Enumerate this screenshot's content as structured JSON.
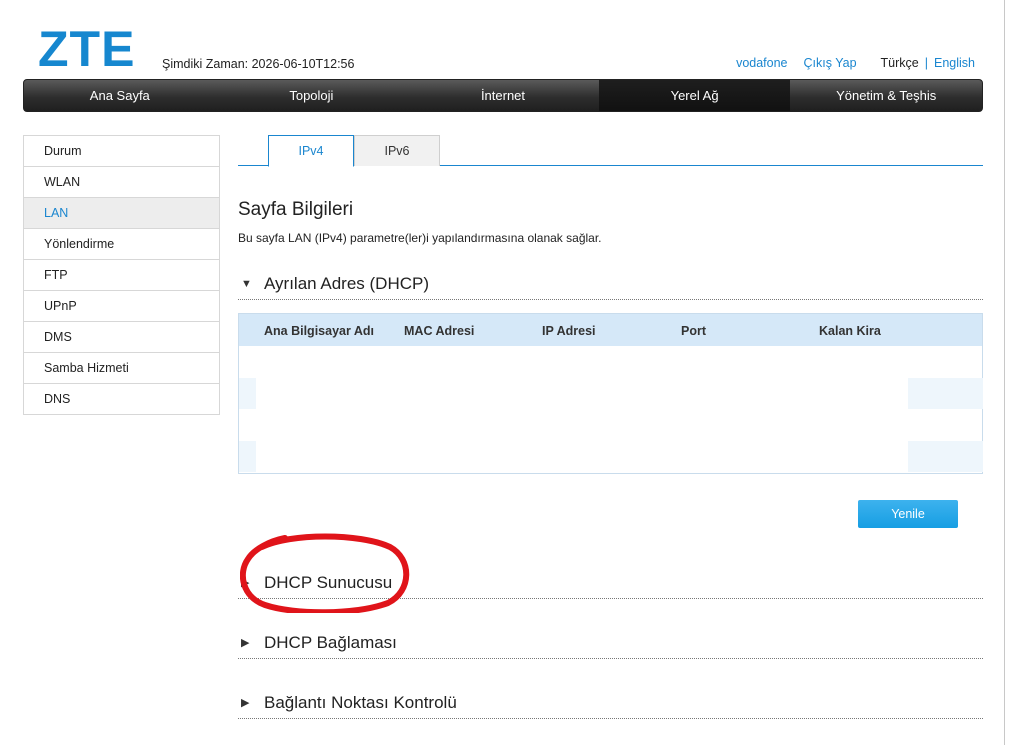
{
  "header": {
    "logo": "ZTE",
    "current_time": "Şimdiki Zaman: 2026-06-10T12:56",
    "links": {
      "operator": "vodafone",
      "logout": "Çıkış Yap",
      "lang_current": "Türkçe",
      "lang_separator": "|",
      "lang_alt": "English"
    }
  },
  "nav": {
    "items": [
      {
        "label": "Ana Sayfa"
      },
      {
        "label": "Topoloji"
      },
      {
        "label": "İnternet"
      },
      {
        "label": "Yerel Ağ"
      },
      {
        "label": "Yönetim & Teşhis"
      }
    ],
    "active": "Yerel Ağ"
  },
  "sidebar": {
    "items": [
      {
        "label": "Durum"
      },
      {
        "label": "WLAN"
      },
      {
        "label": "LAN"
      },
      {
        "label": "Yönlendirme"
      },
      {
        "label": "FTP"
      },
      {
        "label": "UPnP"
      },
      {
        "label": "DMS"
      },
      {
        "label": "Samba Hizmeti"
      },
      {
        "label": "DNS"
      }
    ],
    "active": "LAN"
  },
  "tabs": {
    "items": [
      {
        "label": "IPv4"
      },
      {
        "label": "IPv6"
      }
    ],
    "active": "IPv4"
  },
  "main": {
    "title": "Sayfa Bilgileri",
    "description": "Bu sayfa LAN (IPv4) parametre(ler)i yapılandırmasına olanak sağlar.",
    "dhcp_section": {
      "label": "Ayrılan Adres (DHCP)",
      "expanded": true,
      "columns": [
        "Ana Bilgisayar Adı",
        "MAC Adresi",
        "IP Adresi",
        "Port",
        "Kalan Kira"
      ],
      "rows": []
    },
    "refresh_label": "Yenile",
    "collapsed_sections": [
      {
        "label": "DHCP Sunucusu"
      },
      {
        "label": "DHCP Bağlaması"
      },
      {
        "label": "Bağlantı Noktası Kontrolü"
      }
    ]
  },
  "icons": {
    "expanded": "triangle-down-icon",
    "collapsed": "triangle-right-icon"
  },
  "colors": {
    "accent": "#1a86cf",
    "annotation": "#e0141a",
    "button": "#169ee3"
  }
}
